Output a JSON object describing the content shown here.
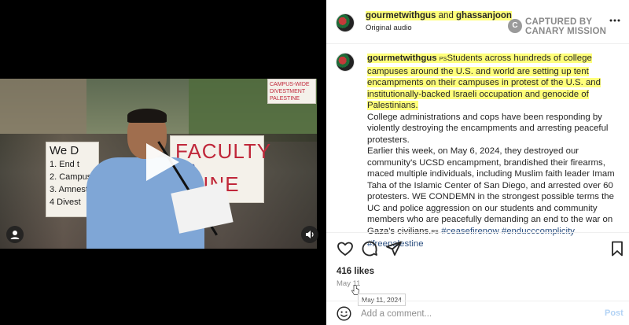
{
  "media": {
    "signs": {
      "we_title": "We D",
      "we_items": [
        "1. End t",
        "2. Campus",
        "3. Amnesty",
        "4 Divest"
      ],
      "faculty_main": "FACULTY",
      "faculty_mid": "FOR",
      "faculty_end": "STINE",
      "top_sign": "CAMPUS-WIDE DIVESTMENT PALESTINE"
    },
    "controls": {
      "user_icon": "user-icon",
      "audio_icon": "speaker-icon",
      "play_icon": "play-icon"
    }
  },
  "header": {
    "author_primary": "gourmetwithgus",
    "author_joiner": " and ",
    "author_secondary": "ghassanjoon",
    "audio_label": "Original audio",
    "stamp_line1": "CAPTURED BY",
    "stamp_line2": "CANARY MISSION",
    "more_icon": "more-options-icon"
  },
  "caption": {
    "username": "gourmetwithgus",
    "ps_mark": "PS",
    "highlighted_text": "Students across hundreds of college campuses around the U.S. and world are setting up tent encampments on their campuses in protest of the U.S. and institutionally-backed Israeli occupation and genocide of Palestinians.",
    "paragraph2": "College administrations and cops have been responding by violently destroying the encampments and arresting peaceful protesters.",
    "paragraph3": "Earlier this week, on May 6, 2024, they destroyed our community's UCSD encampment, brandished their firearms, maced multiple individuals, including Muslim faith leader Imam Taha of the Islamic Center of San Diego, and arrested over 60 protesters. WE CONDEMN in the strongest possible terms the UC and police aggression on our students and community members who are peacefully demanding an end to the war on Gaza's civilians.",
    "ps_mark_end": "PS",
    "hashtags": [
      "#ceasefirenow",
      "#enducccomplicity",
      "#freepalestine"
    ]
  },
  "actions": {
    "like_icon": "heart-icon",
    "comment_icon": "comment-icon",
    "share_icon": "share-icon",
    "save_icon": "bookmark-icon"
  },
  "stats": {
    "likes": "416 likes",
    "date": "May 11",
    "tooltip": "May 11, 2024"
  },
  "comment": {
    "emoji_icon": "emoji-icon",
    "placeholder": "Add a comment...",
    "post_label": "Post"
  },
  "colors": {
    "highlight": "#ffff7a",
    "hashtag": "#2b4f80",
    "post_button_disabled": "#b3d3f5",
    "stamp_gray": "#8a8a8a"
  }
}
